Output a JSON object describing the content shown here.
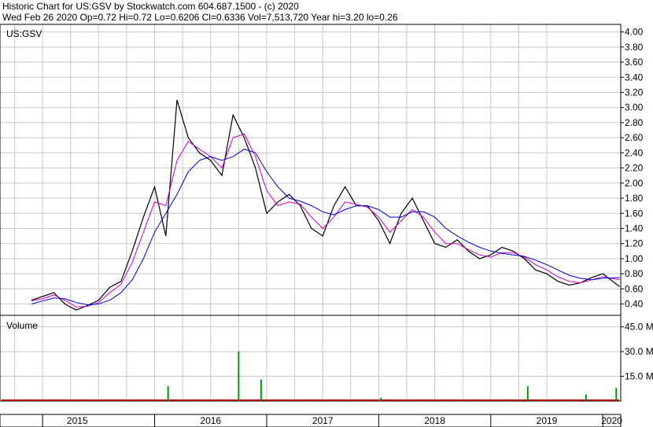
{
  "header": {
    "line1": "Historic Chart for US:GSV by Stockwatch.com 604.687.1500 - (c) 2020",
    "line2": "Wed Feb 26 2020   Op=0.72   Hi=0.72   Lo=0.6206   Cl=0.6336   Vol=7,513,720   Year hi=3.20   lo=0.26"
  },
  "chart_data": {
    "type": "line",
    "price_panel": {
      "symbol_label": "US:GSV",
      "ylim": [
        0.25,
        4.1
      ],
      "y_ticks": [
        "4.00",
        "3.80",
        "3.60",
        "3.40",
        "3.20",
        "3.00",
        "2.80",
        "2.60",
        "2.40",
        "2.20",
        "2.00",
        "1.80",
        "1.60",
        "1.40",
        "1.20",
        "1.00",
        "0.80",
        "0.60",
        "0.40"
      ],
      "x": [
        2014.9,
        2015.0,
        2015.1,
        2015.2,
        2015.3,
        2015.4,
        2015.5,
        2015.6,
        2015.7,
        2015.8,
        2015.9,
        2016.0,
        2016.1,
        2016.2,
        2016.3,
        2016.4,
        2016.5,
        2016.6,
        2016.7,
        2016.8,
        2016.9,
        2017.0,
        2017.1,
        2017.2,
        2017.3,
        2017.4,
        2017.5,
        2017.6,
        2017.7,
        2017.8,
        2017.9,
        2018.0,
        2018.1,
        2018.2,
        2018.3,
        2018.4,
        2018.5,
        2018.6,
        2018.7,
        2018.8,
        2018.9,
        2019.0,
        2019.1,
        2019.2,
        2019.3,
        2019.4,
        2019.5,
        2019.6,
        2019.7,
        2019.8,
        2019.9,
        2020.0,
        2020.15
      ],
      "series": [
        {
          "color": "#000000",
          "width": 1.2,
          "values": [
            0.45,
            0.5,
            0.55,
            0.4,
            0.32,
            0.38,
            0.45,
            0.62,
            0.7,
            1.1,
            1.55,
            1.95,
            1.3,
            3.1,
            2.6,
            2.4,
            2.3,
            2.1,
            2.9,
            2.6,
            2.2,
            1.6,
            1.75,
            1.85,
            1.7,
            1.4,
            1.3,
            1.7,
            1.95,
            1.7,
            1.7,
            1.5,
            1.2,
            1.6,
            1.8,
            1.5,
            1.2,
            1.15,
            1.25,
            1.1,
            1.0,
            1.05,
            1.15,
            1.1,
            1.0,
            0.85,
            0.8,
            0.7,
            0.65,
            0.68,
            0.75,
            0.8,
            0.63
          ]
        },
        {
          "color": "#cc00cc",
          "width": 1,
          "values": [
            0.44,
            0.47,
            0.52,
            0.45,
            0.36,
            0.37,
            0.42,
            0.55,
            0.66,
            0.95,
            1.35,
            1.75,
            1.7,
            2.3,
            2.55,
            2.45,
            2.35,
            2.2,
            2.6,
            2.65,
            2.35,
            1.9,
            1.7,
            1.75,
            1.72,
            1.55,
            1.4,
            1.55,
            1.75,
            1.72,
            1.68,
            1.55,
            1.35,
            1.5,
            1.65,
            1.55,
            1.35,
            1.2,
            1.2,
            1.12,
            1.05,
            1.02,
            1.08,
            1.08,
            1.02,
            0.92,
            0.85,
            0.76,
            0.7,
            0.68,
            0.72,
            0.76,
            0.72
          ]
        },
        {
          "color": "#0000cc",
          "width": 1,
          "values": [
            0.4,
            0.44,
            0.48,
            0.47,
            0.42,
            0.39,
            0.4,
            0.45,
            0.55,
            0.72,
            1.0,
            1.35,
            1.6,
            1.85,
            2.15,
            2.3,
            2.35,
            2.3,
            2.35,
            2.45,
            2.4,
            2.15,
            1.95,
            1.8,
            1.76,
            1.7,
            1.62,
            1.58,
            1.65,
            1.7,
            1.7,
            1.65,
            1.55,
            1.55,
            1.62,
            1.62,
            1.55,
            1.4,
            1.3,
            1.22,
            1.15,
            1.1,
            1.07,
            1.05,
            1.03,
            0.98,
            0.92,
            0.85,
            0.78,
            0.74,
            0.72,
            0.74,
            0.75
          ]
        }
      ]
    },
    "volume_panel": {
      "label": "Volume",
      "ylim": [
        0,
        52
      ],
      "y_ticks": [
        "45.0 M",
        "30.0 M",
        "15.0 M"
      ],
      "spikes": [
        {
          "x": 2016.12,
          "value": 9.0
        },
        {
          "x": 2016.75,
          "value": 30.0
        },
        {
          "x": 2016.95,
          "value": 13.0
        },
        {
          "x": 2018.02,
          "value": 2.0
        },
        {
          "x": 2019.33,
          "value": 9.0
        },
        {
          "x": 2019.85,
          "value": 4.0
        },
        {
          "x": 2020.12,
          "value": 8.0
        }
      ]
    },
    "x_axis": {
      "years": [
        "2015",
        "2016",
        "2017",
        "2018",
        "2019",
        "2020"
      ],
      "year_starts": [
        2015,
        2016,
        2017,
        2018,
        2019,
        2020
      ],
      "xlim": [
        2014.62,
        2020.16
      ]
    },
    "grid": true
  }
}
